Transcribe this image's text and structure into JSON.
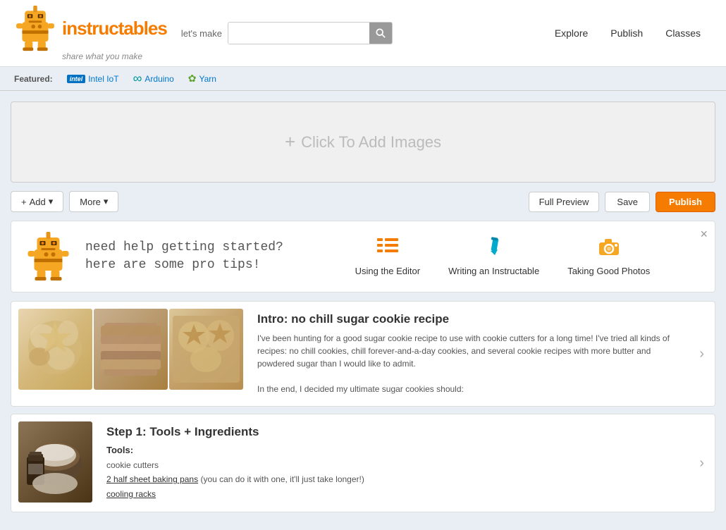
{
  "header": {
    "logo_text": "instructables",
    "tagline": "share what you make",
    "lets_make": "let's make",
    "search_placeholder": "",
    "nav": {
      "explore": "Explore",
      "publish": "Publish",
      "classes": "Classes"
    },
    "featured_label": "Featured:",
    "featured_items": [
      {
        "icon": "intel",
        "label": "Intel IoT"
      },
      {
        "icon": "arduino",
        "label": "Arduino"
      },
      {
        "icon": "yarn",
        "label": "Yarn"
      }
    ]
  },
  "toolbar": {
    "add_label": "Add",
    "more_label": "More",
    "full_preview_label": "Full Preview",
    "save_label": "Save",
    "publish_label": "Publish"
  },
  "image_upload": {
    "label": "Click To Add Images"
  },
  "help_panel": {
    "line1": "need help getting started?",
    "line2": "here are some pro tips!",
    "tips": [
      {
        "label": "Using the Editor",
        "icon": "list"
      },
      {
        "label": "Writing an Instructable",
        "icon": "pencil"
      },
      {
        "label": "Taking Good Photos",
        "icon": "camera"
      }
    ]
  },
  "cards": [
    {
      "title": "Intro: no chill sugar cookie recipe",
      "text": "I've been hunting for a good sugar cookie recipe to use with cookie cutters for a long time! I've tried all kinds of recipes: no chill cookies, chill forever-and-a-day cookies, and several cookie recipes with more butter and powdered sugar than I would like to admit.\n\nIn the end, I decided my ultimate sugar cookies should:"
    },
    {
      "title": "Step 1: Tools + Ingredients",
      "tools_label": "Tools:",
      "tools": [
        "cookie cutters",
        "2 half sheet baking pans (you can do it with one, it'll just take longer!)",
        "cooling racks"
      ]
    }
  ]
}
